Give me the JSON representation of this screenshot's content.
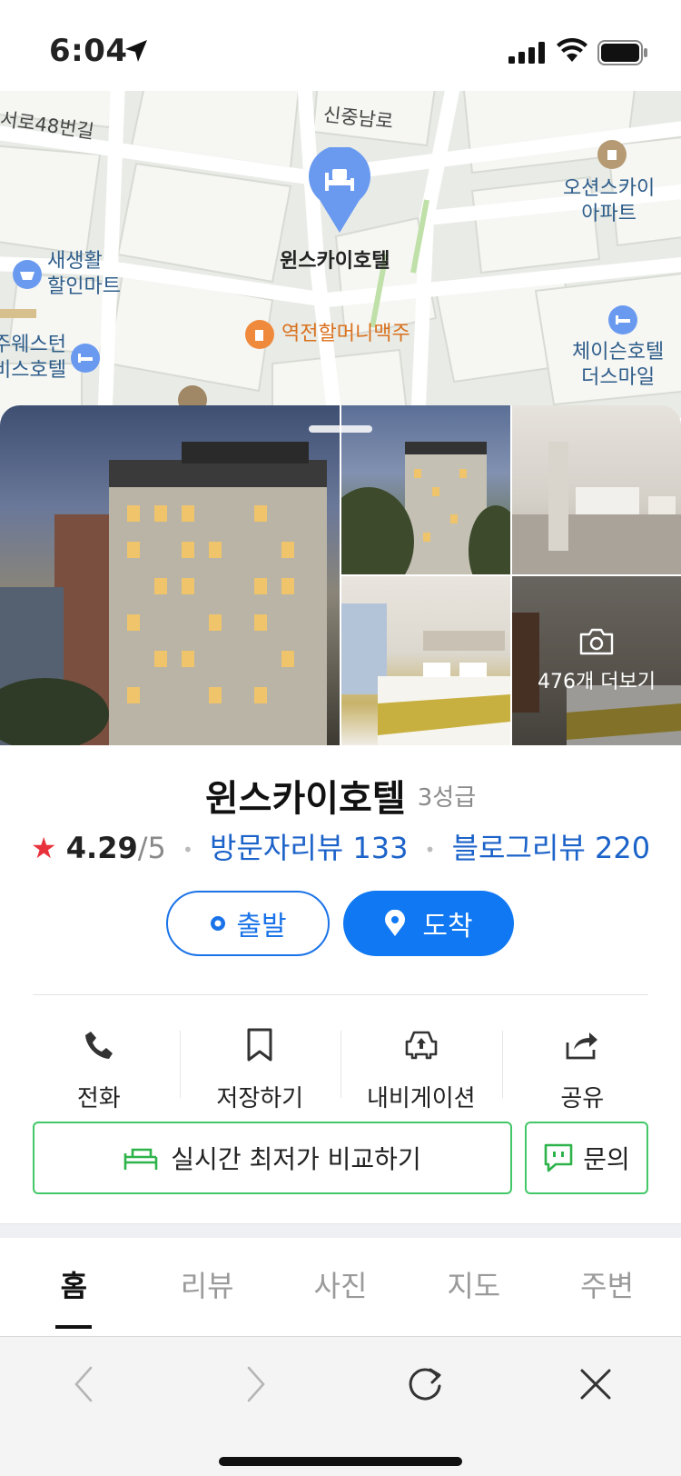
{
  "status_bar": {
    "time": "6:04"
  },
  "map": {
    "streets": [
      "서로48번길",
      "신중남로"
    ],
    "pois": {
      "hotel_selected": "윈스카이호텔",
      "ocean_sky": [
        "오션스카이",
        "아파트"
      ],
      "saesaenghwal": [
        "새생활",
        "할인마트"
      ],
      "beer": "역전할머니맥주",
      "west_hotel": [
        "주웨스턴",
        "비스호텔"
      ],
      "chase_hotel": [
        "체이슨호텔",
        "더스마일"
      ]
    }
  },
  "photos": {
    "more_label": "476개 더보기"
  },
  "place": {
    "name": "윈스카이호텔",
    "grade": "3성급",
    "rating": "4.29",
    "rating_max": "/5",
    "visitor_reviews": "방문자리뷰 133",
    "blog_reviews": "블로그리뷰 220"
  },
  "directions": {
    "depart": "출발",
    "arrive": "도착"
  },
  "actions": [
    {
      "label": "전화",
      "icon": "phone-icon"
    },
    {
      "label": "저장하기",
      "icon": "bookmark-icon"
    },
    {
      "label": "내비게이션",
      "icon": "car-navigation-icon"
    },
    {
      "label": "공유",
      "icon": "share-icon"
    }
  ],
  "compare": {
    "label": "실시간 최저가 비교하기",
    "inquiry": "문의"
  },
  "tabs": [
    {
      "label": "홈",
      "active": true
    },
    {
      "label": "리뷰",
      "active": false
    },
    {
      "label": "사진",
      "active": false
    },
    {
      "label": "지도",
      "active": false
    },
    {
      "label": "주변",
      "active": false
    }
  ],
  "colors": {
    "primary_blue": "#0f78f2",
    "link_blue": "#1c63c9",
    "green_border": "#43c868",
    "star_red": "#e8323c"
  }
}
